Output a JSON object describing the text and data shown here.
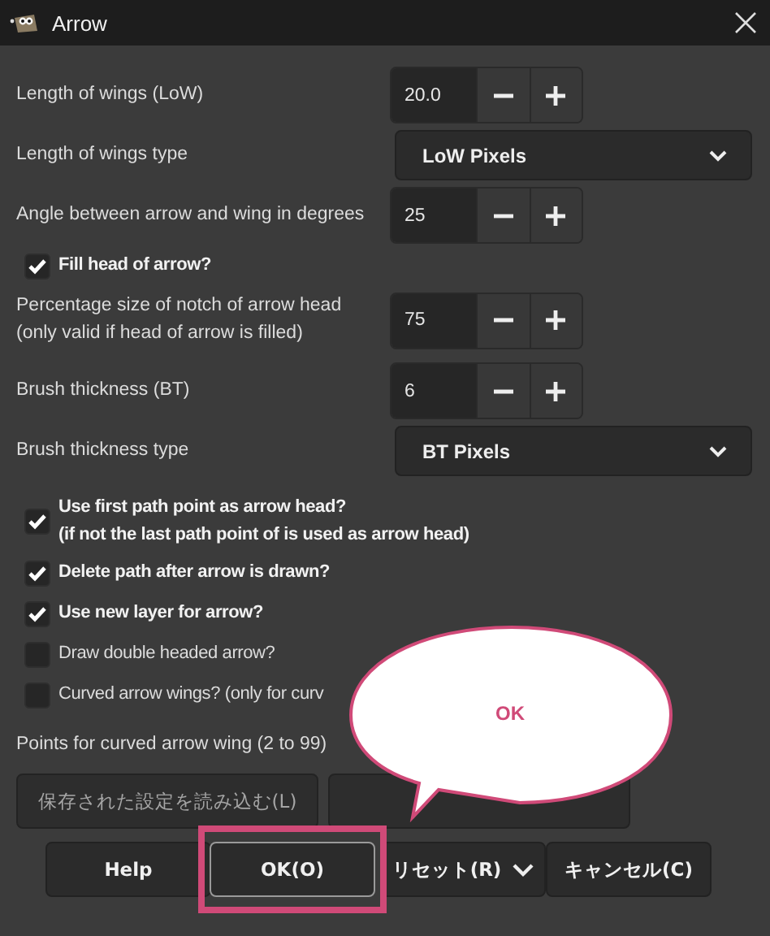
{
  "window": {
    "title": "Arrow"
  },
  "rows": [
    {
      "kind": "spin",
      "label": "Length of wings (LoW)",
      "value": "20.0"
    },
    {
      "kind": "combo",
      "label": "Length of wings type",
      "value": "LoW Pixels"
    },
    {
      "kind": "spin",
      "label": "Angle between arrow and wing in degrees",
      "value": "25"
    },
    {
      "kind": "check",
      "label": "Fill head of arrow?",
      "checked": true
    },
    {
      "kind": "spin",
      "label": "Percentage size of notch of arrow head",
      "note": "(only valid if head of arrow is filled)",
      "value": "75"
    },
    {
      "kind": "spin",
      "label": "Brush thickness (BT)",
      "value": "6"
    },
    {
      "kind": "combo",
      "label": "Brush thickness type",
      "value": "BT Pixels"
    },
    {
      "kind": "check",
      "label": "Use first path point as arrow head?",
      "note": "(if not the last path point of is used as arrow head)",
      "checked": true
    },
    {
      "kind": "check",
      "label": "Delete path after arrow is drawn?",
      "checked": true
    },
    {
      "kind": "check",
      "label": "Use new layer for arrow?",
      "checked": true
    },
    {
      "kind": "check",
      "label": "Draw double headed arrow?",
      "checked": false
    },
    {
      "kind": "check",
      "label": "Curved arrow wings? (only for curv",
      "checked": false
    },
    {
      "kind": "text",
      "label": "Points for curved arrow wing (2 to 99)"
    }
  ],
  "settings_buttons": [
    {
      "label": "保存された設定を読み込む(L)"
    }
  ],
  "buttons": [
    {
      "kind": "plain",
      "label": "Help",
      "focused": false,
      "highlighted": false
    },
    {
      "kind": "plain",
      "label": "OK(O)",
      "focused": true,
      "highlighted": true
    },
    {
      "kind": "menu",
      "label": "リセット(R)",
      "focused": false,
      "highlighted": false
    },
    {
      "kind": "plain",
      "label": "キャンセル(C)",
      "focused": false,
      "highlighted": false
    }
  ],
  "callout": {
    "text": "OK"
  }
}
